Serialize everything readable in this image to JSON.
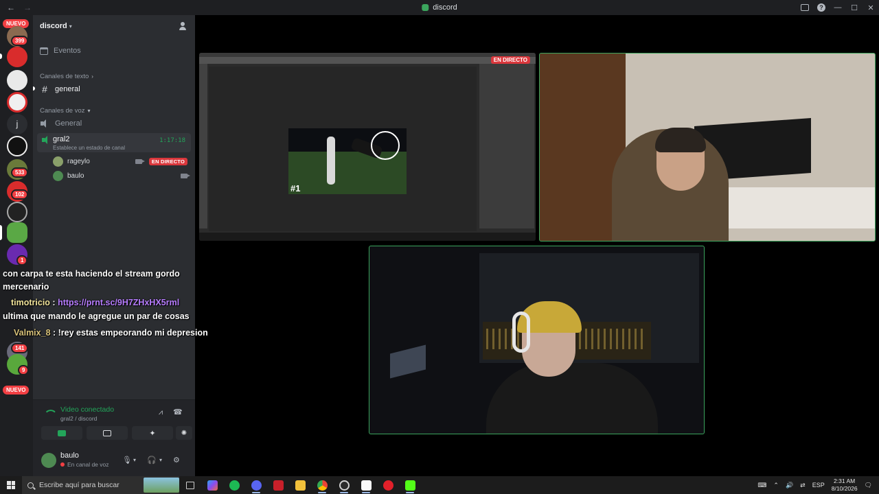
{
  "window": {
    "title": "discord",
    "back": "←",
    "forward": "→"
  },
  "rail": {
    "nuevo_top": "NUEVO",
    "nuevo_bottom": "NUEVO",
    "badges": [
      "399",
      "533",
      "102",
      "141",
      "9",
      "1"
    ],
    "letter_server": "j"
  },
  "sidebar": {
    "guild_name": "discord",
    "events_label": "Eventos",
    "text_category": "Canales de texto",
    "text_channel": "general",
    "voice_category": "Canales de voz",
    "voice_channel_1": "General",
    "voice_channel_2": {
      "name": "gral2",
      "status": "Establece un estado de canal",
      "timer": "1:17:18"
    },
    "members": [
      {
        "name": "rageylo",
        "live": "EN DIRECTO"
      },
      {
        "name": "baulo"
      }
    ]
  },
  "voice_panel": {
    "status": "Video conectado",
    "channel": "gral2 / discord"
  },
  "user_panel": {
    "username": "baulo",
    "status": "En canal de voz"
  },
  "chat": {
    "lines": [
      {
        "text": "con carpa te esta haciendo el stream gordo"
      },
      {
        "text": "mercenario"
      },
      {
        "user": "timotricio",
        "sep": " : ",
        "link": "https://prnt.sc/9H7ZHxHX5rml"
      },
      {
        "text": "ultima que mando le agregue un par de cosas"
      },
      {
        "user": "Valmix_8",
        "sep": " : ",
        "text": "!rey estas empeorando mi depresion"
      }
    ]
  },
  "stream": {
    "live_tag": "EN DIRECTO",
    "clip_number": "#1"
  },
  "taskbar": {
    "search_placeholder": "Escribe aquí para buscar",
    "language": "ESP",
    "time": "2:31 AM",
    "date": "8/10/2026"
  },
  "colors": {
    "speaking_border": "#3ba55d",
    "live_red": "#da373c",
    "badge_red": "#f23f43",
    "connected_green": "#23a55a"
  }
}
